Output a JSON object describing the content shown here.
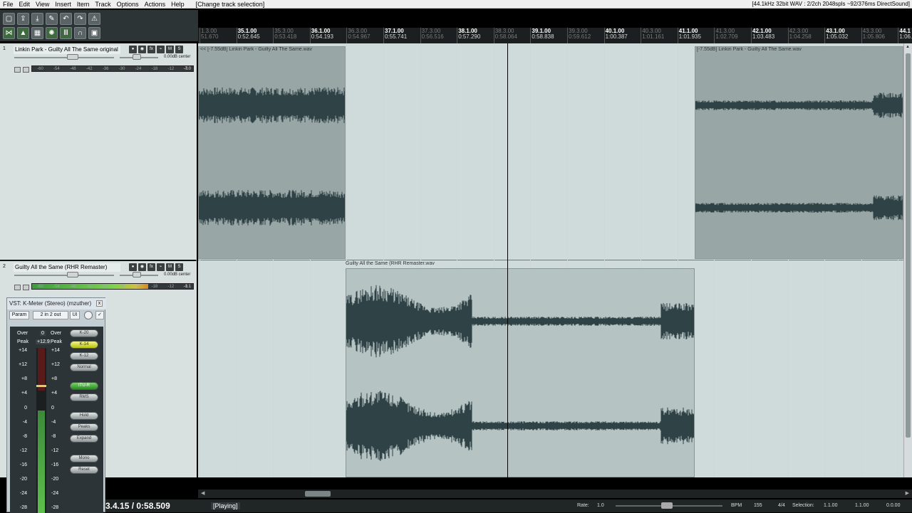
{
  "menu": {
    "items": [
      "File",
      "Edit",
      "View",
      "Insert",
      "Item",
      "Track",
      "Options",
      "Actions",
      "Help"
    ],
    "track_selection": "[Change track selection]",
    "status": "[44.1kHz 32bit WAV : 2/2ch 2048spls ~92/376ms DirectSound]"
  },
  "toolbar": {
    "row1": [
      "new-icon",
      "open-icon",
      "save-icon",
      "settings-icon",
      "undo-icon",
      "redo-icon",
      "metronome-icon"
    ],
    "row2": [
      "snap-icon",
      "ripple-icon",
      "grid-icon",
      "env-icon",
      "bars-icon",
      "mag-icon",
      "lock-icon"
    ]
  },
  "ruler": {
    "marks": [
      {
        "bar": "1.3.00",
        "time": "51.670",
        "dim": true
      },
      {
        "bar": "35.1.00",
        "time": "0:52.645",
        "dim": false
      },
      {
        "bar": "35.3.00",
        "time": "0:53.418",
        "dim": true
      },
      {
        "bar": "36.1.00",
        "time": "0:54.193",
        "dim": false
      },
      {
        "bar": "36.3.00",
        "time": "0:54.967",
        "dim": true
      },
      {
        "bar": "37.1.00",
        "time": "0:55.741",
        "dim": false
      },
      {
        "bar": "37.3.00",
        "time": "0:56.516",
        "dim": true
      },
      {
        "bar": "38.1.00",
        "time": "0:57.290",
        "dim": false
      },
      {
        "bar": "38.3.00",
        "time": "0:58.064",
        "dim": true
      },
      {
        "bar": "39.1.00",
        "time": "0:58.838",
        "dim": false
      },
      {
        "bar": "39.3.00",
        "time": "0:59.612",
        "dim": true
      },
      {
        "bar": "40.1.00",
        "time": "1:00.387",
        "dim": false
      },
      {
        "bar": "40.3.00",
        "time": "1:01.161",
        "dim": true
      },
      {
        "bar": "41.1.00",
        "time": "1:01.935",
        "dim": false
      },
      {
        "bar": "41.3.00",
        "time": "1:02.709",
        "dim": true
      },
      {
        "bar": "42.1.00",
        "time": "1:03.483",
        "dim": false
      },
      {
        "bar": "42.3.00",
        "time": "1:04.258",
        "dim": true
      },
      {
        "bar": "43.1.00",
        "time": "1:05.032",
        "dim": false
      },
      {
        "bar": "43.3.00",
        "time": "1:05.806",
        "dim": true
      },
      {
        "bar": "44.1",
        "time": "1:06.5",
        "dim": false
      }
    ]
  },
  "tracks": [
    {
      "num": "1",
      "name": "Linkin Park - Guilty All The Same original",
      "volume": "0.00dB center",
      "peak": "-7.0",
      "meter_fraction": 0.0
    },
    {
      "num": "2",
      "name": "Guilty All the Same (RHR Remaster)",
      "volume": "0.00dB center",
      "peak": "-1.1",
      "meter_fraction": 0.72
    }
  ],
  "meter_scale": [
    "-60",
    "-54",
    "-48",
    "-42",
    "-36",
    "-30",
    "-24",
    "-18",
    "-12",
    "-6"
  ],
  "items": [
    {
      "label": "<< [-7.55dB] Linkin Park - Guilty All The Same.wav"
    },
    {
      "label": "[-7.55dB] Linkin Park - Guilty All The Same.wav"
    },
    {
      "label": "Guilty All the Same (RHR Remaster.wav"
    }
  ],
  "kmeter": {
    "title": "VST: K-Meter (Stereo) (mzuther)",
    "close": "x",
    "param": "Param",
    "io": "2 in 2 out",
    "ui": "UI",
    "enabled": "✓",
    "over_label": "Over",
    "over_value": "0",
    "peak_label": "Peak",
    "peak_value": "+12.9",
    "scale": [
      "+14",
      "+12",
      "+8",
      "+4",
      "0",
      "-4",
      "-8",
      "-12",
      "-16",
      "-20",
      "-24",
      "-28"
    ],
    "level_fraction": 0.62,
    "buttons": [
      {
        "label": "K-20",
        "state": "off"
      },
      {
        "label": "K-14",
        "state": "yellow"
      },
      {
        "label": "K-12",
        "state": "off"
      },
      {
        "label": "Normal",
        "state": "off"
      },
      {
        "label": "ITU-R",
        "state": "green"
      },
      {
        "label": "RMS",
        "state": "off"
      },
      {
        "label": "Hold",
        "state": "off"
      },
      {
        "label": "Peaks",
        "state": "off"
      },
      {
        "label": "Expand",
        "state": "off"
      },
      {
        "label": "Mono",
        "state": "off"
      },
      {
        "label": "Reset",
        "state": "off"
      }
    ]
  },
  "transport": {
    "position": "3.4.15 / 0:58.509",
    "state": "[Playing]",
    "rate_label": "Rate:",
    "rate_value": "1.0",
    "bpm_label": "BPM",
    "bpm_value": "155",
    "time_sig": "4/4",
    "selection_label": "Selection:",
    "sel_start": "1.1.00",
    "sel_end": "1.1.00",
    "sel_len": "0.0.00"
  }
}
